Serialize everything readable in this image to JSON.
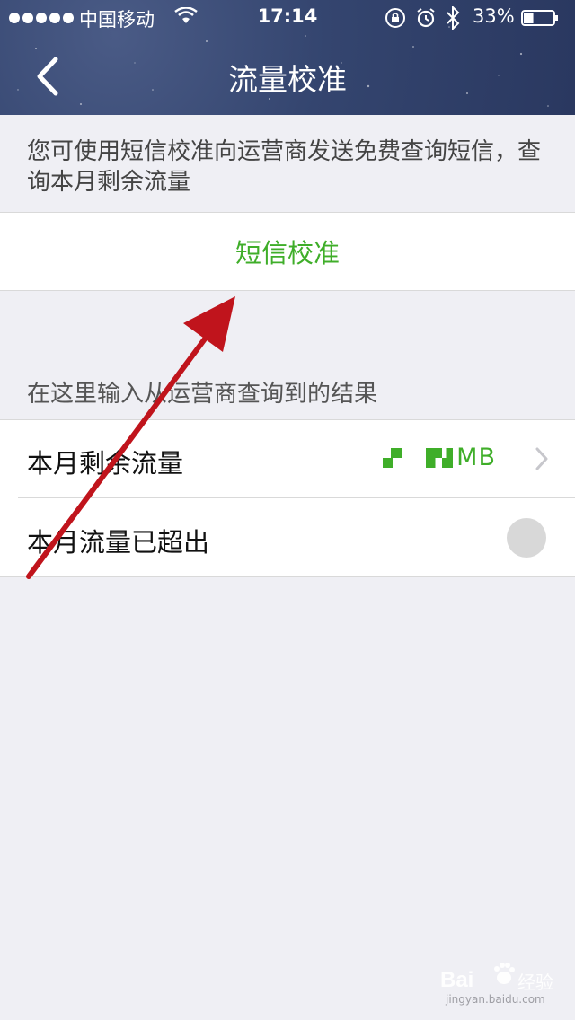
{
  "status_bar": {
    "carrier": "中国移动",
    "time": "17:14",
    "battery_percent": "33%",
    "battery_level": 0.33,
    "icons": [
      "signal-dots-icon",
      "wifi-icon",
      "rotation-lock-icon",
      "alarm-icon",
      "bluetooth-icon",
      "battery-icon"
    ]
  },
  "header": {
    "title": "流量校准",
    "back_icon": "chevron-left-icon"
  },
  "intro_text": "您可使用短信校准向运营商发送免费查询短信，查询本月剩余流量",
  "sms_calibrate_button": "短信校准",
  "section_caption": "在这里输入从运营商查询到的结果",
  "rows": [
    {
      "label": "本月剩余流量",
      "value_unit": "MB",
      "value_obscured": true,
      "accessory": "chevron-right-icon"
    },
    {
      "label": "本月流量已超出",
      "accessory": "toggle"
    }
  ],
  "colors": {
    "accent_green": "#3fae29",
    "annotation_arrow": "#c0141c",
    "background": "#efeff4",
    "header_bg": "#34456f"
  },
  "watermark": {
    "brand": "Bai",
    "name": "经验",
    "url": "jingyan.baidu.com"
  }
}
